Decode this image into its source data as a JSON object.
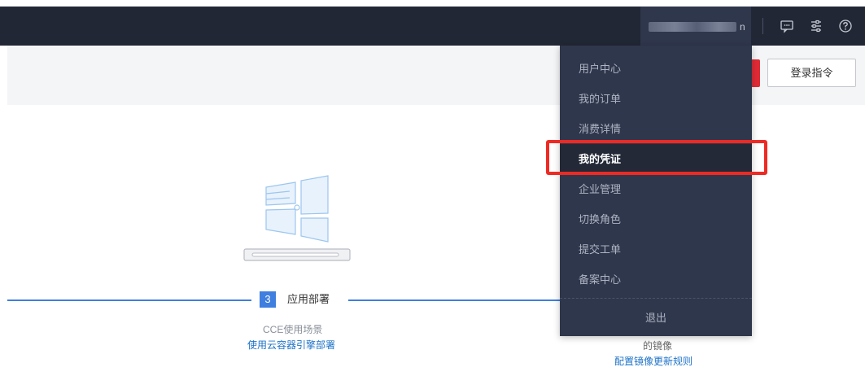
{
  "topbar": {
    "account_suffix": "n",
    "icons": [
      "message-icon",
      "settings-sliders-icon",
      "help-icon"
    ]
  },
  "toolbar": {
    "login_command_label": "登录指令"
  },
  "steps": {
    "deploy": {
      "number": "3",
      "title": "应用部署",
      "scenario": "CCE使用场景",
      "link": "使用云容器引擎部署"
    },
    "mirror": {
      "text": "的镜像",
      "link": "配置镜像更新规则"
    }
  },
  "dropdown": {
    "items": [
      {
        "label": "用户中心"
      },
      {
        "label": "我的订单"
      },
      {
        "label": "消费详情"
      },
      {
        "label": "我的凭证"
      },
      {
        "label": "企业管理"
      },
      {
        "label": "切换角色"
      },
      {
        "label": "提交工单"
      },
      {
        "label": "备案中心"
      }
    ],
    "active_index": 3,
    "logout_label": "退出"
  },
  "colors": {
    "topbar": "#222735",
    "dropdown_bg": "#2f374d",
    "accent_blue": "#3e7fe0",
    "link_blue": "#1e73c8",
    "highlight_red": "#ee2a24",
    "brand_red": "#e02b36"
  }
}
